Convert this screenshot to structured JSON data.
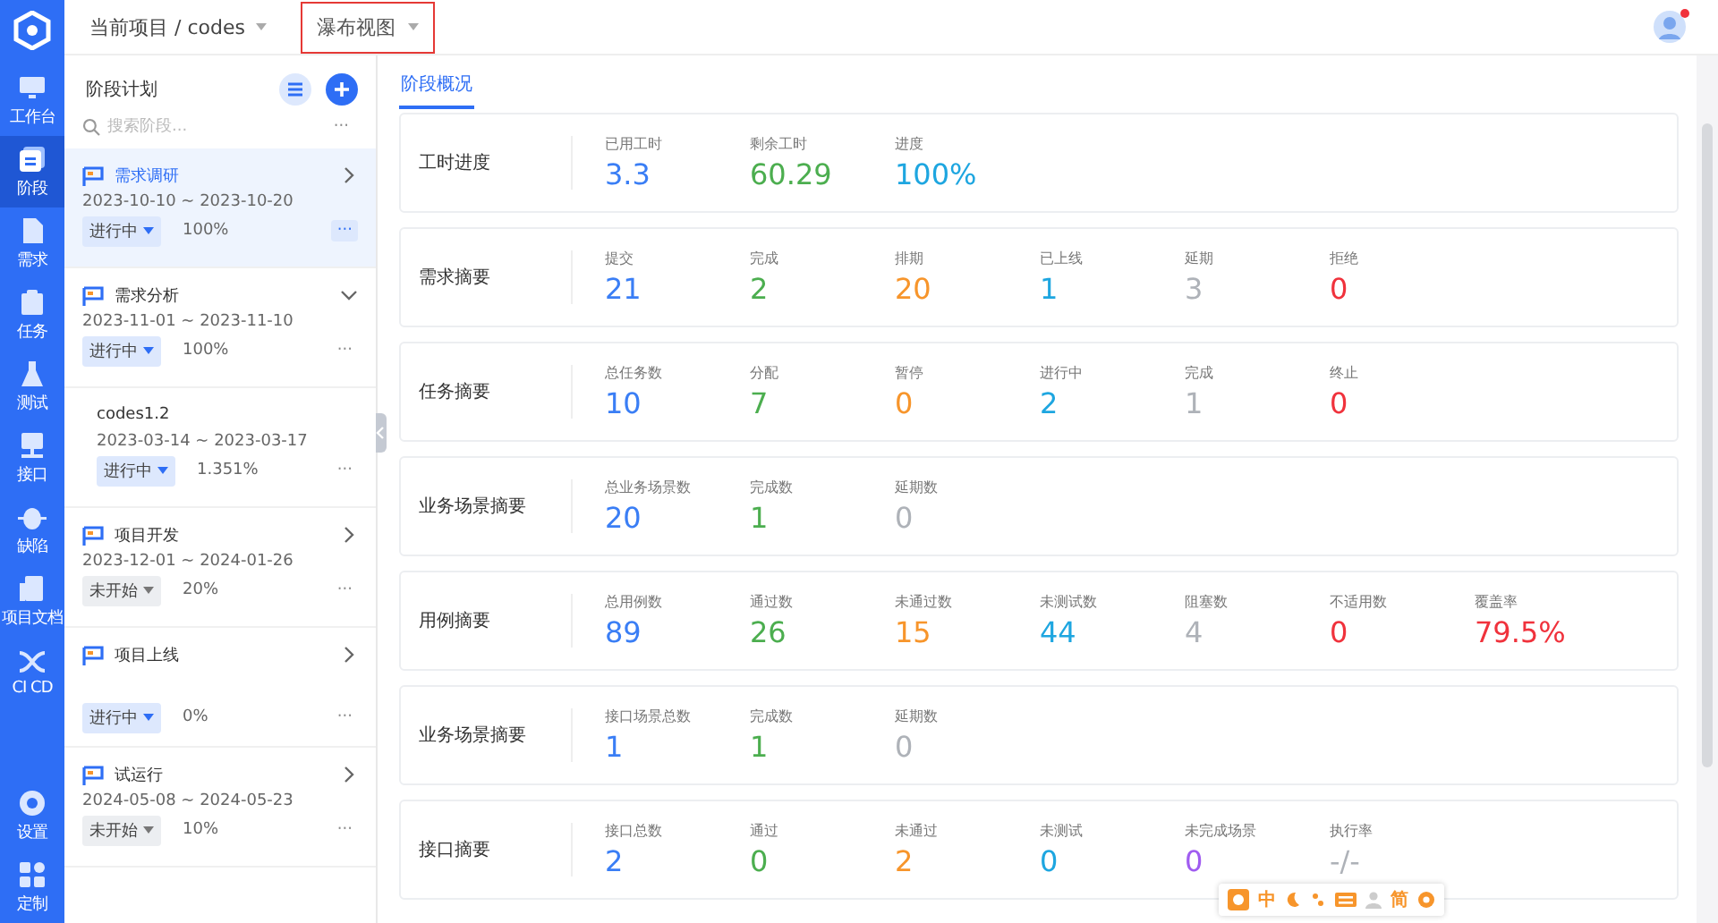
{
  "nav": {
    "items": [
      {
        "label": "工作台",
        "selected": false
      },
      {
        "label": "阶段",
        "selected": true
      },
      {
        "label": "需求",
        "selected": false
      },
      {
        "label": "任务",
        "selected": false
      },
      {
        "label": "测试",
        "selected": false
      },
      {
        "label": "接口",
        "selected": false
      },
      {
        "label": "缺陷",
        "selected": false
      },
      {
        "label": "项目文档",
        "selected": false
      },
      {
        "label": "CI CD",
        "selected": false
      }
    ],
    "bottom": [
      {
        "label": "设置",
        "selected": false
      },
      {
        "label": "定制",
        "selected": false
      }
    ]
  },
  "topbar": {
    "project": "当前项目 / codes",
    "view": "瀑布视图"
  },
  "stage_panel": {
    "title": "阶段计划",
    "search": {
      "placeholder": "搜索阶段..."
    },
    "more": "···",
    "stages": [
      {
        "name": "需求调研",
        "dates": "2023-10-10 ~ 2023-10-20",
        "status": {
          "label": "进行中",
          "kind": "active"
        },
        "progress": "100%",
        "selected": true,
        "expanded": false
      },
      {
        "name": "需求分析",
        "dates": "2023-11-01 ~ 2023-11-10",
        "status": {
          "label": "进行中",
          "kind": "active"
        },
        "progress": "100%",
        "selected": false,
        "expanded": true,
        "children": [
          {
            "name": "codes1.2",
            "dates": "2023-03-14 ~ 2023-03-17",
            "status": {
              "label": "进行中",
              "kind": "active"
            },
            "progress": "1.351%",
            "selected": false
          }
        ]
      },
      {
        "name": "项目开发",
        "dates": "2023-12-01 ~ 2024-01-26",
        "status": {
          "label": "未开始",
          "kind": "pending"
        },
        "progress": "20%",
        "selected": false,
        "expanded": false
      },
      {
        "name": "项目上线",
        "status": {
          "label": "进行中",
          "kind": "active"
        },
        "progress": "0%",
        "selected": false,
        "expanded": false
      },
      {
        "name": "试运行",
        "dates": "2024-05-08 ~ 2024-05-23",
        "status": {
          "label": "未开始",
          "kind": "pending"
        },
        "progress": "10%",
        "selected": false,
        "expanded": false
      }
    ]
  },
  "tabs": [
    {
      "label": "阶段概况",
      "selected": true
    }
  ],
  "sections": [
    {
      "title": "工时进度",
      "metrics": [
        {
          "label": "已用工时",
          "value": "3.3",
          "color": "#3a7ef5"
        },
        {
          "label": "剩余工时",
          "value": "60.29",
          "color": "#4cae4f"
        },
        {
          "label": "进度",
          "value": "100%",
          "color": "#1ea6e0"
        }
      ]
    },
    {
      "title": "需求摘要",
      "metrics": [
        {
          "label": "提交",
          "value": "21",
          "color": "#3a7ef5"
        },
        {
          "label": "完成",
          "value": "2",
          "color": "#4cae4f"
        },
        {
          "label": "排期",
          "value": "20",
          "color": "#f7952b"
        },
        {
          "label": "已上线",
          "value": "1",
          "color": "#1ea6e0"
        },
        {
          "label": "延期",
          "value": "3",
          "color": "#aeb2b8"
        },
        {
          "label": "拒绝",
          "value": "0",
          "color": "#f0323c"
        }
      ]
    },
    {
      "title": "任务摘要",
      "metrics": [
        {
          "label": "总任务数",
          "value": "10",
          "color": "#3a7ef5"
        },
        {
          "label": "分配",
          "value": "7",
          "color": "#4cae4f"
        },
        {
          "label": "暂停",
          "value": "0",
          "color": "#f7952b"
        },
        {
          "label": "进行中",
          "value": "2",
          "color": "#1ea6e0"
        },
        {
          "label": "完成",
          "value": "1",
          "color": "#aeb2b8"
        },
        {
          "label": "终止",
          "value": "0",
          "color": "#f0323c"
        }
      ]
    },
    {
      "title": "业务场景摘要",
      "metrics": [
        {
          "label": "总业务场景数",
          "value": "20",
          "color": "#3a7ef5"
        },
        {
          "label": "完成数",
          "value": "1",
          "color": "#4cae4f"
        },
        {
          "label": "延期数",
          "value": "0",
          "color": "#aeb2b8"
        }
      ]
    },
    {
      "title": "用例摘要",
      "metrics": [
        {
          "label": "总用例数",
          "value": "89",
          "color": "#3a7ef5"
        },
        {
          "label": "通过数",
          "value": "26",
          "color": "#4cae4f"
        },
        {
          "label": "未通过数",
          "value": "15",
          "color": "#f7952b"
        },
        {
          "label": "未测试数",
          "value": "44",
          "color": "#1ea6e0"
        },
        {
          "label": "阻塞数",
          "value": "4",
          "color": "#aeb2b8"
        },
        {
          "label": "不适用数",
          "value": "0",
          "color": "#f0323c"
        },
        {
          "label": "覆盖率",
          "value": "79.5%",
          "color": "#f0323c"
        }
      ]
    },
    {
      "title": "业务场景摘要",
      "metrics": [
        {
          "label": "接口场景总数",
          "value": "1",
          "color": "#3a7ef5"
        },
        {
          "label": "完成数",
          "value": "1",
          "color": "#4cae4f"
        },
        {
          "label": "延期数",
          "value": "0",
          "color": "#aeb2b8"
        }
      ]
    },
    {
      "title": "接口摘要",
      "metrics": [
        {
          "label": "接口总数",
          "value": "2",
          "color": "#3a7ef5"
        },
        {
          "label": "通过",
          "value": "0",
          "color": "#4cae4f"
        },
        {
          "label": "未通过",
          "value": "2",
          "color": "#f7952b"
        },
        {
          "label": "未测试",
          "value": "0",
          "color": "#1ea6e0"
        },
        {
          "label": "未完成场景",
          "value": "0",
          "color": "#a05cf0"
        },
        {
          "label": "执行率",
          "value": "-/-",
          "color": "#aeb2b8"
        }
      ]
    }
  ],
  "ime_bar": {
    "mode": "中",
    "script": "简"
  }
}
